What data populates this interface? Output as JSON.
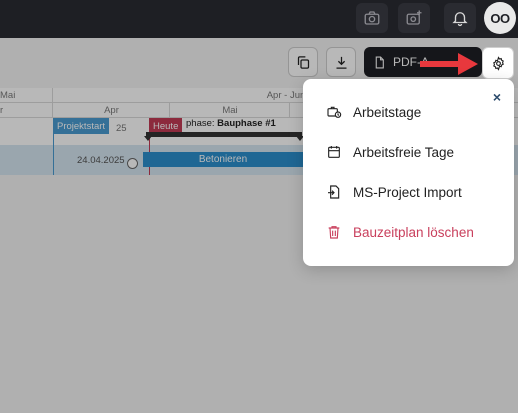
{
  "topbar": {
    "icons": [
      "camera-icon",
      "add-photo-icon",
      "bell-icon"
    ],
    "avatar_initials": "OO"
  },
  "toolbar": {
    "copy_icon": "copy-icon",
    "download_icon": "download-icon",
    "pdf_label": "PDF-A",
    "settings_icon": "gear-icon"
  },
  "gantt": {
    "header_top": {
      "left": "Mai",
      "center": "Apr - Jun"
    },
    "header_mid": {
      "left": "r",
      "apr": "Apr",
      "mai": "Mai"
    },
    "tags": {
      "start": "Projektstart",
      "today": "Heute",
      "start_suffix": "25"
    },
    "phase_label_prefix": "phase: ",
    "phase_label_name": "Bauphase #1",
    "row_date": "24.04.2025",
    "task_label": "Betonieren"
  },
  "settings_menu": {
    "close": "×",
    "items": [
      {
        "label": "Arbeitstage",
        "icon": "briefcase-clock-icon"
      },
      {
        "label": "Arbeitsfreie Tage",
        "icon": "calendar-icon"
      },
      {
        "label": "MS-Project Import",
        "icon": "file-import-icon"
      },
      {
        "label": "Bauzeitplan löschen",
        "icon": "trash-icon",
        "danger": true
      }
    ]
  },
  "colors": {
    "accent_blue": "#2c8fce",
    "today_red": "#c23b55",
    "danger": "#c9405d",
    "dark": "#1e1f24"
  }
}
